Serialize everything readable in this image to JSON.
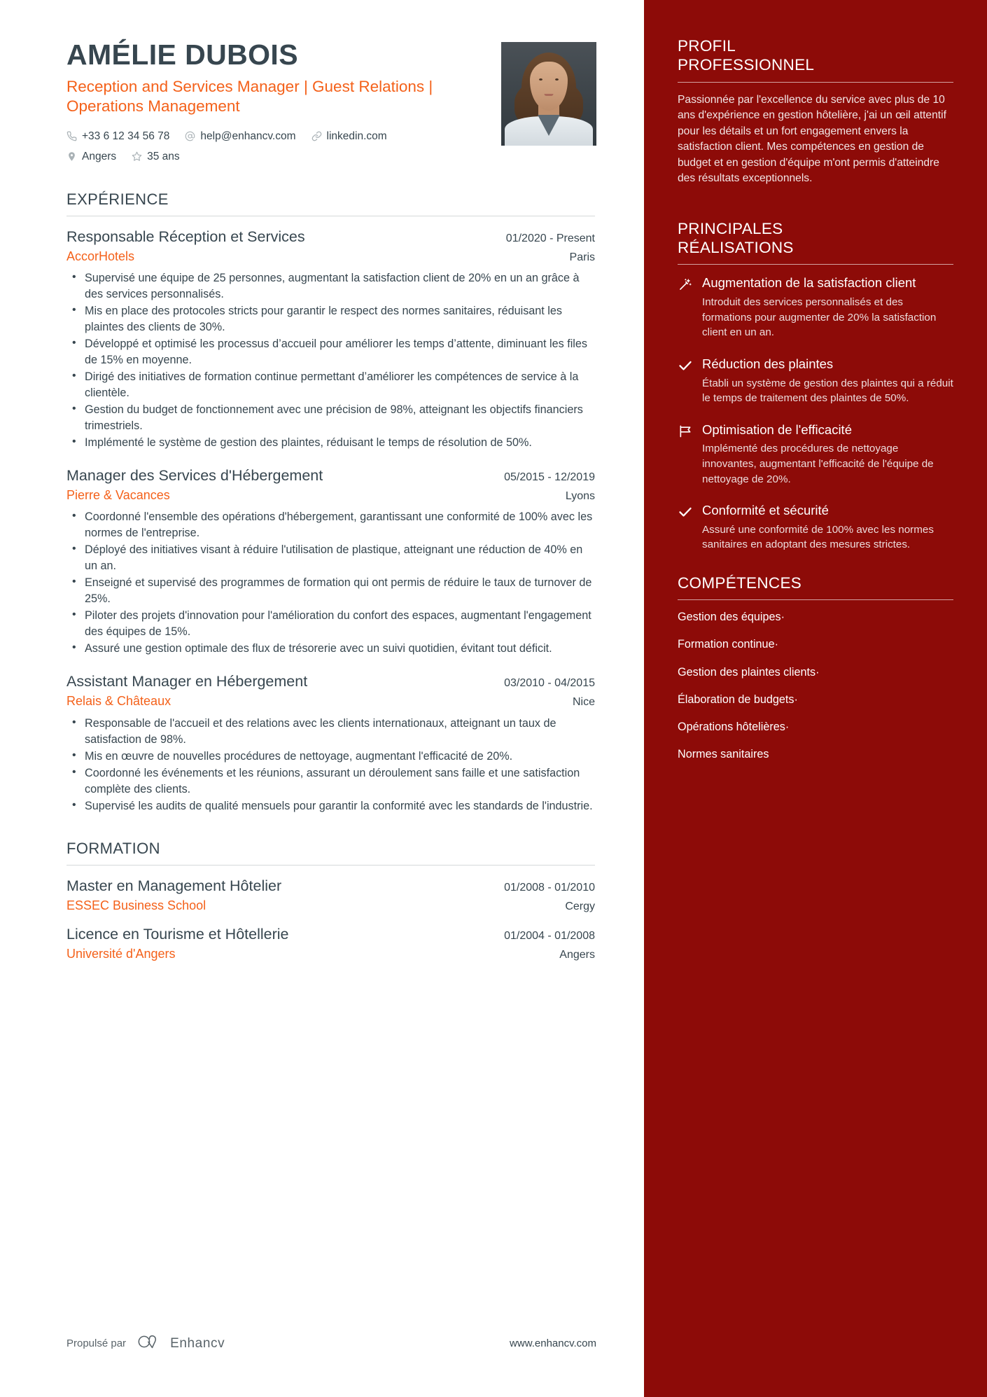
{
  "colors": {
    "sidebar_bg": "#8d0b08",
    "accent_orange": "#f4611a",
    "text_dark": "#37464f"
  },
  "header": {
    "name": "AMÉLIE DUBOIS",
    "headline": "Reception and Services Manager | Guest Relations | Operations Management",
    "contacts": [
      {
        "icon": "phone-icon",
        "text": "+33 6 12 34 56 78"
      },
      {
        "icon": "email-icon",
        "text": "help@enhancv.com"
      },
      {
        "icon": "link-icon",
        "text": "linkedin.com"
      },
      {
        "icon": "location-pin-icon",
        "text": "Angers"
      },
      {
        "icon": "star-icon",
        "text": "35 ans"
      }
    ]
  },
  "experience": {
    "title": "EXPÉRIENCE",
    "entries": [
      {
        "role": "Responsable Réception et Services",
        "dates": "01/2020 - Present",
        "company": "AccorHotels",
        "location": "Paris",
        "bullets": [
          "Supervisé une équipe de 25 personnes, augmentant la satisfaction client de 20% en un an grâce à des services personnalisés.",
          "Mis en place des protocoles stricts pour garantir le respect des normes sanitaires, réduisant les plaintes des clients de 30%.",
          "Développé et optimisé les processus d’accueil pour améliorer les temps d’attente, diminuant les files de 15% en moyenne.",
          "Dirigé des initiatives de formation continue permettant d’améliorer les compétences de service à la clientèle.",
          "Gestion du budget de fonctionnement avec une précision de 98%, atteignant les objectifs financiers trimestriels.",
          "Implémenté le système de gestion des plaintes, réduisant le temps de résolution de 50%."
        ]
      },
      {
        "role": "Manager des Services d'Hébergement",
        "dates": "05/2015 - 12/2019",
        "company": "Pierre & Vacances",
        "location": "Lyons",
        "bullets": [
          "Coordonné l'ensemble des opérations d'hébergement, garantissant une conformité de 100% avec les normes de l'entreprise.",
          "Déployé des initiatives visant à réduire l'utilisation de plastique, atteignant une réduction de 40% en un an.",
          "Enseigné et supervisé des programmes de formation qui ont permis de réduire le taux de turnover de 25%.",
          "Piloter des projets d'innovation pour l'amélioration du confort des espaces, augmentant l'engagement des équipes de 15%.",
          "Assuré une gestion optimale des flux de trésorerie avec un suivi quotidien, évitant tout déficit."
        ]
      },
      {
        "role": "Assistant Manager en Hébergement",
        "dates": "03/2010 - 04/2015",
        "company": "Relais & Châteaux",
        "location": "Nice",
        "bullets": [
          "Responsable de l'accueil et des relations avec les clients internationaux, atteignant un taux de satisfaction de 98%.",
          "Mis en œuvre de nouvelles procédures de nettoyage, augmentant l'efficacité de 20%.",
          "Coordonné les événements et les réunions, assurant un déroulement sans faille et une satisfaction complète des clients.",
          "Supervisé les audits de qualité mensuels pour garantir la conformité avec les standards de l'industrie."
        ]
      }
    ]
  },
  "education": {
    "title": "FORMATION",
    "entries": [
      {
        "degree": "Master en Management Hôtelier",
        "dates": "01/2008 - 01/2010",
        "school": "ESSEC Business School",
        "location": "Cergy"
      },
      {
        "degree": "Licence en Tourisme et Hôtellerie",
        "dates": "01/2004 - 01/2008",
        "school": "Université d'Angers",
        "location": "Angers"
      }
    ]
  },
  "footer": {
    "powered_by": "Propulsé par",
    "brand": "Enhancv",
    "url": "www.enhancv.com"
  },
  "sidebar": {
    "profile": {
      "title_line1": "PROFIL",
      "title_line2": "PROFESSIONNEL",
      "body": "Passionnée par l'excellence du service avec plus de 10 ans d'expérience en gestion hôtelière, j'ai un œil attentif pour les détails et un fort engagement envers la satisfaction client. Mes compétences en gestion de budget et en gestion d'équipe m'ont permis d'atteindre des résultats exceptionnels."
    },
    "achievements": {
      "title_line1": "PRINCIPALES",
      "title_line2": "RÉALISATIONS",
      "items": [
        {
          "icon": "magic-wand-icon",
          "title": "Augmentation de la satisfaction client",
          "desc": "Introduit des services personnalisés et des formations pour augmenter de 20% la satisfaction client en un an."
        },
        {
          "icon": "check-icon",
          "title": "Réduction des plaintes",
          "desc": "Établi un système de gestion des plaintes qui a réduit le temps de traitement des plaintes de 50%."
        },
        {
          "icon": "flag-icon",
          "title": "Optimisation de l'efficacité",
          "desc": "Implémenté des procédures de nettoyage innovantes, augmentant l'efficacité de l'équipe de nettoyage de 20%."
        },
        {
          "icon": "check-icon",
          "title": "Conformité et sécurité",
          "desc": "Assuré une conformité de 100% avec les normes sanitaires en adoptant des mesures strictes."
        }
      ]
    },
    "skills": {
      "title": "COMPÉTENCES",
      "items": [
        {
          "name": "Gestion des équipes",
          "sep": "·"
        },
        {
          "name": "Formation continue",
          "sep": "·"
        },
        {
          "name": "Gestion des plaintes clients",
          "sep": "·"
        },
        {
          "name": "Élaboration de budgets",
          "sep": "·"
        },
        {
          "name": "Opérations hôtelières",
          "sep": "·"
        },
        {
          "name": "Normes sanitaires",
          "sep": ""
        }
      ]
    }
  }
}
